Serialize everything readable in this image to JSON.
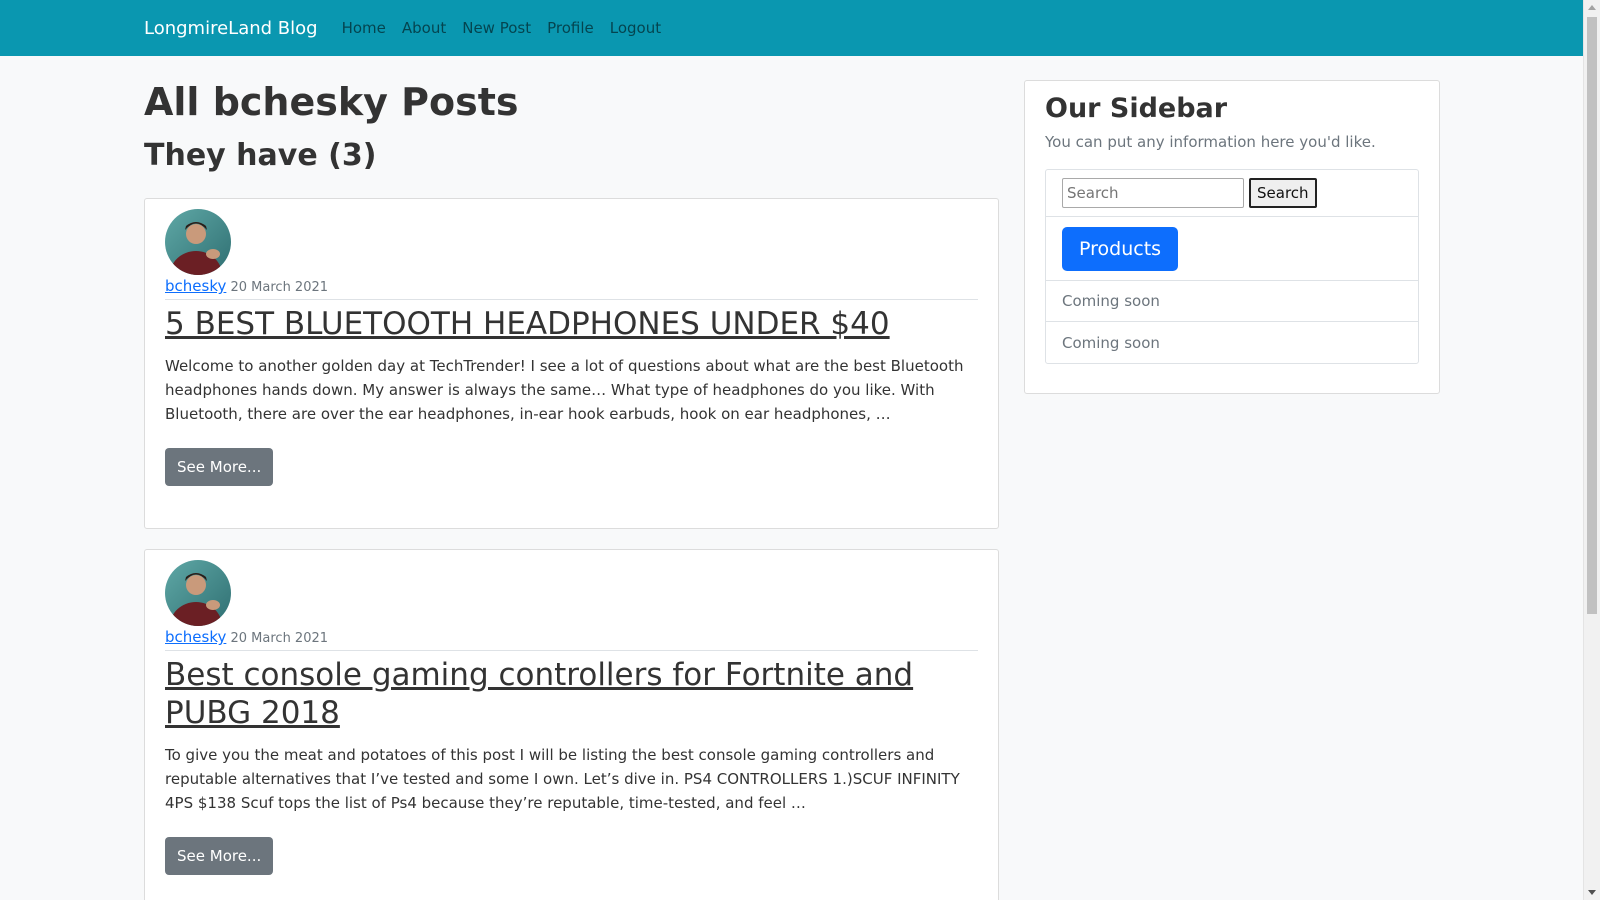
{
  "navbar": {
    "brand": "LongmireLand Blog",
    "links": [
      "Home",
      "About",
      "New Post",
      "Profile",
      "Logout"
    ]
  },
  "main": {
    "page_title": "All bchesky Posts",
    "count_title": "They have (3)",
    "posts": [
      {
        "author": "bchesky",
        "date": "20 March 2021",
        "title": "5 BEST BLUETOOTH HEADPHONES UNDER $40",
        "excerpt": "Welcome to another golden day at TechTrender! I see a lot of questions about what are the best Bluetooth headphones hands down. My answer is always the same… What type of headphones do you like. With Bluetooth, there are over the ear headphones, in-ear hook earbuds, hook on ear headphones, …",
        "button": "See More..."
      },
      {
        "author": "bchesky",
        "date": "20 March 2021",
        "title": "Best console gaming controllers for Fortnite and PUBG 2018",
        "excerpt": "To give you the meat and potatoes of this post I will be listing the best console gaming controllers and reputable alternatives that I’ve tested and some I own. Let’s dive in. PS4 CONTROLLERS 1.)SCUF INFINITY 4PS $138 Scuf tops the list of Ps4 because they’re reputable, time-tested, and feel …",
        "button": "See More..."
      }
    ]
  },
  "sidebar": {
    "title": "Our Sidebar",
    "description": "You can put any information here you'd like.",
    "search_placeholder": "Search",
    "search_button": "Search",
    "products_button": "Products",
    "items": [
      "Coming soon",
      "Coming soon"
    ]
  },
  "colors": {
    "navbar": "#0a97b0",
    "primary": "#0d6efd",
    "secondary": "#6c757d"
  }
}
